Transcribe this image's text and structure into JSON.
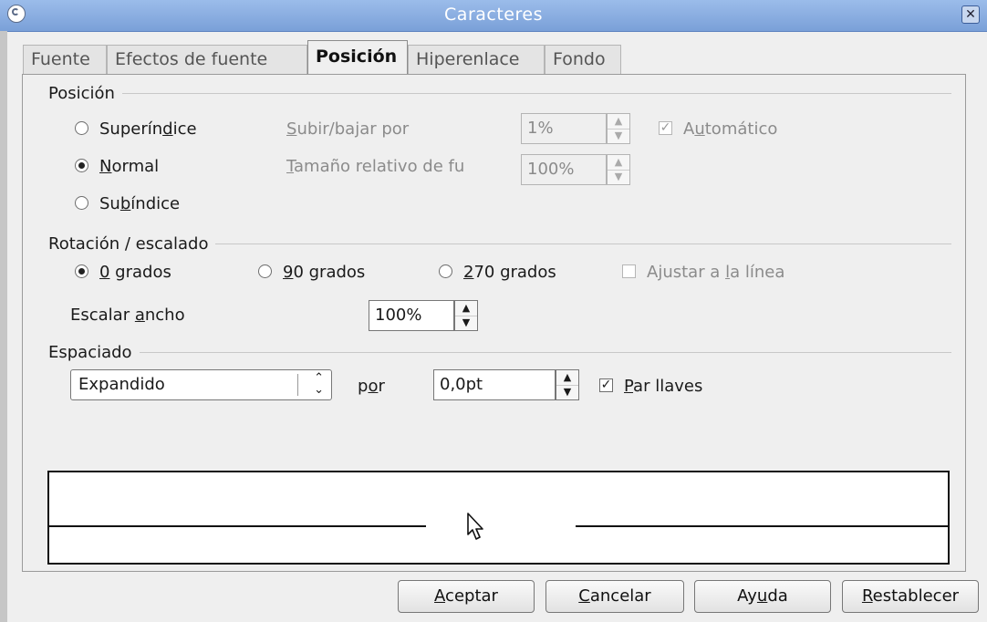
{
  "window": {
    "title": "Caracteres",
    "icon": "app-icon",
    "close_glyph": "✕"
  },
  "tabs": [
    {
      "label": "Fuente",
      "active": false
    },
    {
      "label": "Efectos de fuente",
      "active": false
    },
    {
      "label": "Posición",
      "active": true
    },
    {
      "label": "Hiperenlace",
      "active": false
    },
    {
      "label": "Fondo",
      "active": false
    }
  ],
  "posicion": {
    "heading": "Posición",
    "superindice": {
      "pre": "Superín",
      "ul": "d",
      "post": "ice",
      "selected": false
    },
    "normal": {
      "pre": "",
      "ul": "N",
      "post": "ormal",
      "selected": true
    },
    "subindice": {
      "pre": "Su",
      "ul": "b",
      "post": "índice",
      "selected": false
    },
    "subir_bajar": {
      "pre": "",
      "ul": "S",
      "post": "ubir/bajar por",
      "value": "1%",
      "enabled": false
    },
    "tamano": {
      "pre": "",
      "ul": "T",
      "post": "amaño relativo de fu",
      "value": "100%",
      "enabled": false
    },
    "automatico": {
      "pre": "A",
      "ul": "u",
      "post": "tomático",
      "checked": true,
      "enabled": false
    }
  },
  "rotacion": {
    "heading": "Rotación / escalado",
    "g0": {
      "pre": "",
      "ul": "0",
      "post": " grados",
      "selected": true
    },
    "g90": {
      "pre": "",
      "ul": "9",
      "post": "0 grados",
      "selected": false
    },
    "g270": {
      "pre": "",
      "ul": "2",
      "post": "70 grados",
      "selected": false
    },
    "ajustar": {
      "pre": "Ajustar a ",
      "ul": "l",
      "post": "a línea",
      "checked": false,
      "enabled": false
    },
    "escalar": {
      "pre": "Escalar ",
      "ul": "a",
      "post": "ncho",
      "value": "100%"
    }
  },
  "espaciado": {
    "heading": "Espaciado",
    "mode_value": "Expandido",
    "por": {
      "pre": "p",
      "ul": "o",
      "post": "r"
    },
    "amount": "0,0pt",
    "par_llaves": {
      "pre": "",
      "ul": "P",
      "post": "ar llaves",
      "checked": true
    }
  },
  "buttons": {
    "aceptar": {
      "pre": "",
      "ul": "A",
      "post": "ceptar"
    },
    "cancelar": {
      "pre": "",
      "ul": "C",
      "post": "ancelar"
    },
    "ayuda": {
      "pre": "Ay",
      "ul": "u",
      "post": "da"
    },
    "restablecer": {
      "pre": "",
      "ul": "R",
      "post": "establecer"
    }
  },
  "glyphs": {
    "check": "✓",
    "up": "▲",
    "down": "▼",
    "combo_up": "⌃",
    "combo_down": "⌄"
  }
}
